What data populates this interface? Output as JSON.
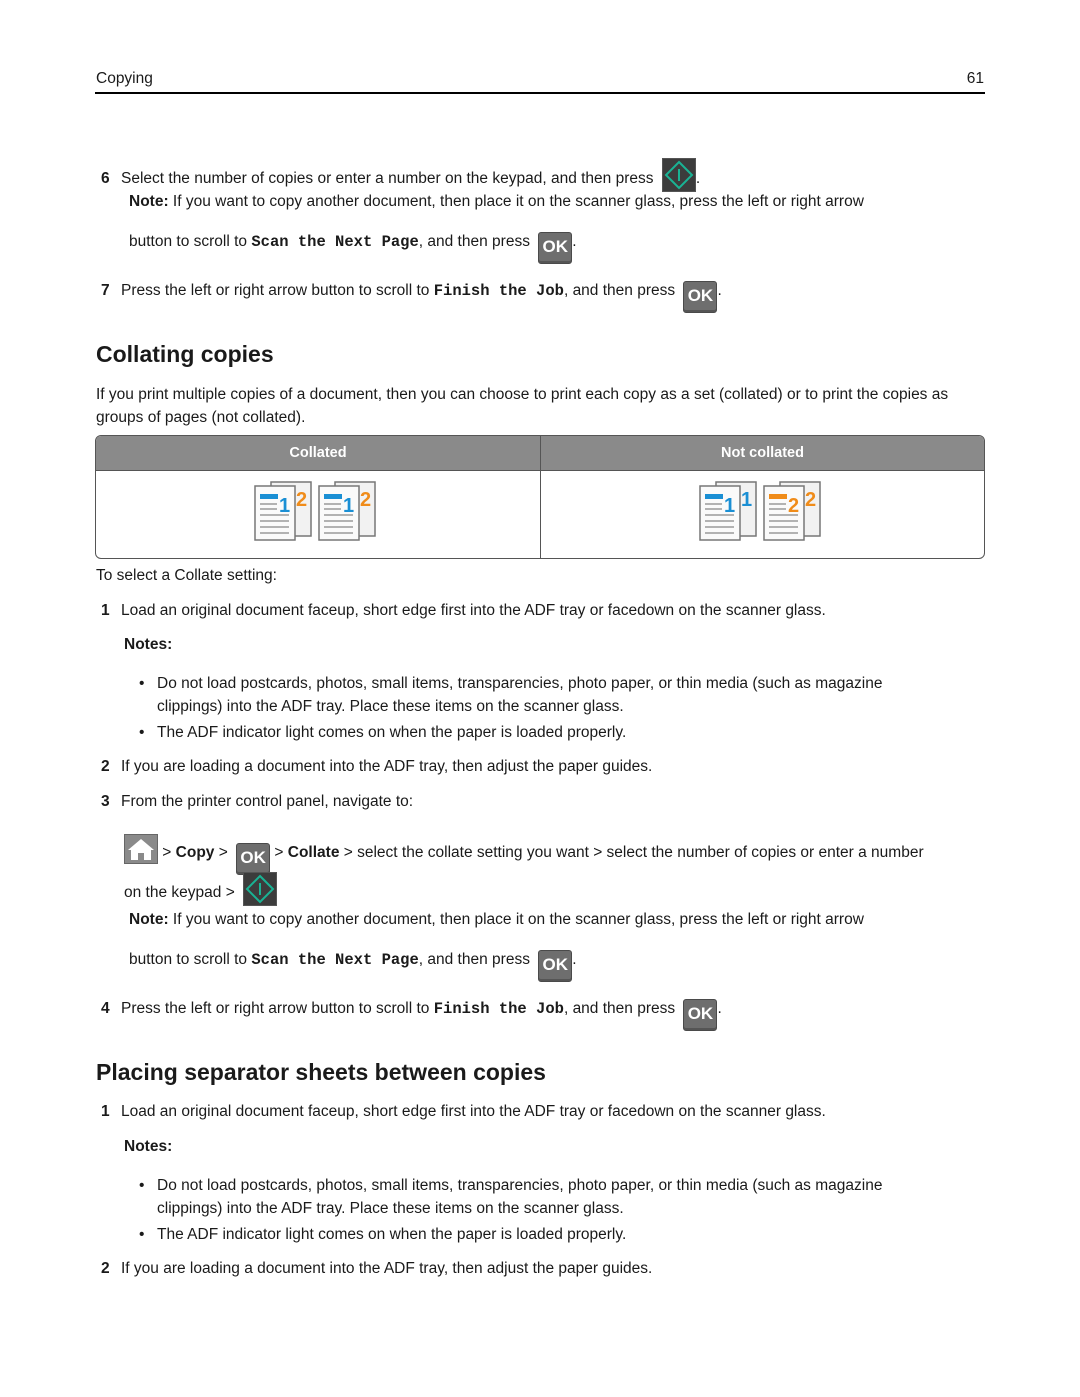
{
  "header": {
    "section": "Copying",
    "page_number": "61"
  },
  "step6": {
    "num": "6",
    "text": "Select the number of copies or enter a number on the keypad, and then press",
    "end": ".",
    "note_label": "Note:",
    "note_line1": " If you want to copy another document, then place it on the scanner glass, press the left or right arrow",
    "note_line2_pre": "button to scroll to ",
    "note_line2_mono": "Scan the Next Page",
    "note_line2_post": ", and then press",
    "ok_label": "OK",
    "end2": "."
  },
  "step7": {
    "num": "7",
    "pre": "Press the left or right arrow button to scroll to ",
    "mono": "Finish the Job",
    "post": ", and then press",
    "ok_label": "OK",
    "end": "."
  },
  "collating": {
    "heading": "Collating copies",
    "intro": "If you print multiple copies of a document, then you can choose to print each copy as a set (collated) or to print the copies as groups of pages (not collated).",
    "table": {
      "headers": [
        "Collated",
        "Not collated"
      ],
      "collated_pages": [
        "1",
        "2",
        "1",
        "2"
      ],
      "not_collated_pages": [
        "1",
        "1",
        "2",
        "2"
      ]
    },
    "select_intro": "To select a Collate setting:",
    "steps": [
      {
        "num": "1",
        "text": "Load an original document faceup, short edge first into the ADF tray or facedown on the scanner glass."
      },
      {
        "num": "2",
        "text": "If you are loading a document into the ADF tray, then adjust the paper guides."
      },
      {
        "num": "3",
        "text": "From the printer control panel, navigate to:"
      }
    ],
    "notes_label": "Notes:",
    "notes": [
      {
        "line1": "Do not load postcards, photos, small items, transparencies, photo paper, or thin media (such as magazine",
        "line2": "clippings) into the ADF tray. Place these items on the scanner glass."
      },
      {
        "line1": "The ADF indicator light comes on when the paper is loaded properly."
      }
    ],
    "nav": {
      "sep1": " > ",
      "copy": "Copy",
      "sep2": " > ",
      "ok_label": "OK",
      "sep3": " > ",
      "collate": "Collate",
      "rest": " > select the collate setting you want > select the number of copies or enter a number",
      "line2": "on the keypad >"
    },
    "note_label": "Note:",
    "note_line1": " If you want to copy another document, then place it on the scanner glass, press the left or right arrow",
    "note_line2_pre": "button to scroll to ",
    "note_line2_mono": "Scan the Next Page",
    "note_line2_post": ", and then press",
    "ok_label": "OK",
    "step4": {
      "num": "4",
      "pre": "Press the left or right arrow button to scroll to ",
      "mono": "Finish the Job",
      "post": ", and then press",
      "end": "."
    }
  },
  "separator": {
    "heading": "Placing separator sheets between copies",
    "steps": [
      {
        "num": "1",
        "text": "Load an original document faceup, short edge first into the ADF tray or facedown on the scanner glass."
      },
      {
        "num": "2",
        "text": "If you are loading a document into the ADF tray, then adjust the paper guides."
      }
    ],
    "notes_label": "Notes:",
    "notes": [
      {
        "line1": "Do not load postcards, photos, small items, transparencies, photo paper, or thin media (such as magazine",
        "line2": "clippings) into the ADF tray. Place these items on the scanner glass."
      },
      {
        "line1": "The ADF indicator light comes on when the paper is loaded properly."
      }
    ]
  },
  "colors": {
    "accent_teal": "#19b394",
    "page_blue": "#1a8fd4",
    "page_orange": "#f08c1a",
    "table_header": "#8a8a8a"
  },
  "icons": {
    "start": "start-diamond-icon",
    "ok": "ok-button-icon",
    "home": "home-icon"
  }
}
